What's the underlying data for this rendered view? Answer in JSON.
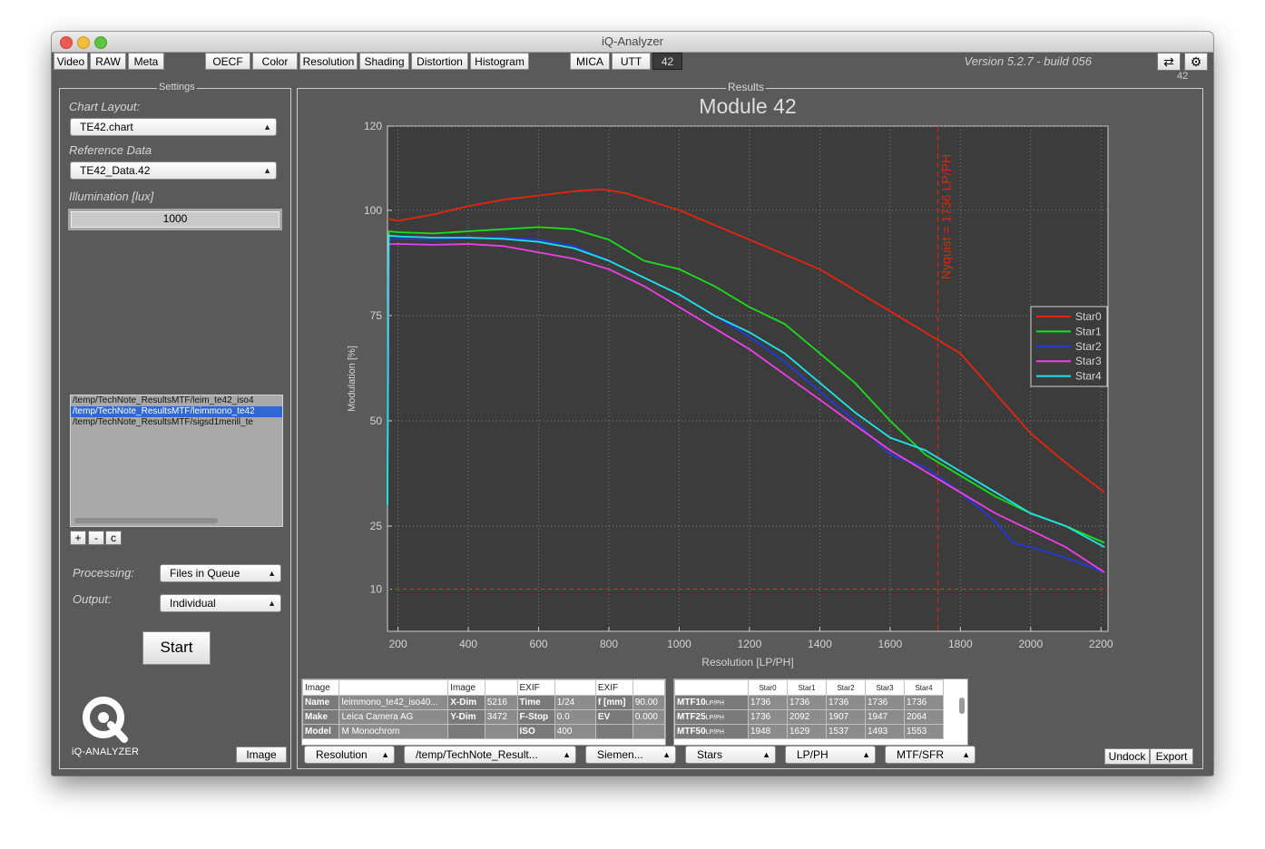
{
  "window": {
    "title": "iQ-Analyzer"
  },
  "toolbar": {
    "tabs": [
      "Video",
      "RAW",
      "Meta",
      "OECF",
      "Color",
      "Resolution",
      "Shading",
      "Distortion",
      "Histogram",
      "MICA",
      "UTT",
      "42"
    ],
    "active_tab": "42",
    "version": "Version 5.2.7 - build 056",
    "swap_icon": "swap-arrows-icon",
    "gear_icon": "gear-icon",
    "corner_label": "42"
  },
  "settings": {
    "group_label": "Settings",
    "chart_layout_label": "Chart Layout:",
    "chart_layout_value": "TE42.chart",
    "reference_label": "Reference Data",
    "reference_value": "TE42_Data.42",
    "illumination_label": "Illumination [lux]",
    "illumination_value": "1000",
    "files": [
      "/temp/TechNote_ResultsMTF/leim_te42_iso4",
      "/temp/TechNote_ResultsMTF/leimmono_te42",
      "/temp/TechNote_ResultsMTF/sigsd1merill_te"
    ],
    "selected_file_index": 1,
    "add_label": "+",
    "remove_label": "-",
    "clear_label": "c",
    "processing_label": "Processing:",
    "processing_value": "Files in Queue",
    "output_label": "Output:",
    "output_value": "Individual",
    "start_label": "Start",
    "logo_text": "iQ-ANALYZER",
    "image_button": "Image"
  },
  "results": {
    "group_label": "Results",
    "exif_table": {
      "headers": [
        "Image",
        "",
        "Image",
        "",
        "EXIF",
        "",
        "EXIF",
        ""
      ],
      "rows": [
        [
          "Name",
          "leimmono_te42_iso40...",
          "X-Dim",
          "5216",
          "Time",
          "1/24",
          "f [mm]",
          "90.00"
        ],
        [
          "Make",
          "Leica Camera AG",
          "Y-Dim",
          "3472",
          "F-Stop",
          "0.0",
          "EV",
          "0.000"
        ],
        [
          "Model",
          "M Monochrom",
          "",
          "",
          "ISO",
          "400",
          "",
          ""
        ]
      ]
    },
    "mtf_table": {
      "headers": [
        "",
        "Star0",
        "Star1",
        "Star2",
        "Star3",
        "Star4"
      ],
      "rows": [
        {
          "label": "MTF10",
          "unit": "LP/PH",
          "values": [
            "1736",
            "1736",
            "1736",
            "1736",
            "1736"
          ]
        },
        {
          "label": "MTF25",
          "unit": "LP/PH",
          "values": [
            "1736",
            "2092",
            "1907",
            "1947",
            "2064"
          ]
        },
        {
          "label": "MTF50",
          "unit": "LP/PH",
          "values": [
            "1948",
            "1629",
            "1537",
            "1493",
            "1553"
          ]
        }
      ]
    },
    "bottom_popups": [
      "Resolution",
      "/temp/TechNote_Result...",
      "Siemen...",
      "Stars",
      "LP/PH",
      "MTF/SFR"
    ],
    "undock_label": "Undock",
    "export_label": "Export"
  },
  "chart_data": {
    "type": "line",
    "title": "Module 42",
    "xlabel": "Resolution [LP/PH]",
    "ylabel": "Modulation [%]",
    "xlim": [
      170,
      2220
    ],
    "ylim": [
      0,
      120
    ],
    "xticks": [
      200,
      400,
      600,
      800,
      1000,
      1200,
      1400,
      1600,
      1800,
      2000,
      2200
    ],
    "yticks": [
      10,
      25,
      50,
      75,
      100,
      120
    ],
    "grid": true,
    "legend_position": "right",
    "nyquist": {
      "x": 1736,
      "label": "Nyquist = 1736 LP/PH",
      "color": "#d52a10"
    },
    "reference_line": {
      "y": 10,
      "color": "#d52a10"
    },
    "series": [
      {
        "name": "Star0",
        "color": "#e8240c",
        "x": [
          170,
          200,
          300,
          400,
          500,
          600,
          700,
          780,
          850,
          1000,
          1200,
          1400,
          1600,
          1700,
          1800,
          2000,
          2100,
          2210
        ],
        "y": [
          98,
          97.5,
          99,
          101,
          102.5,
          103.5,
          104.5,
          105,
          104,
          100,
          93,
          86,
          76,
          71,
          66,
          47,
          40,
          33
        ]
      },
      {
        "name": "Star1",
        "color": "#1adf1c",
        "x": [
          170,
          172,
          174,
          200,
          300,
          400,
          500,
          600,
          700,
          800,
          900,
          1000,
          1100,
          1200,
          1300,
          1400,
          1500,
          1600,
          1700,
          1800,
          1900,
          2000,
          2100,
          2210
        ],
        "y": [
          31,
          75,
          95,
          94.8,
          94.5,
          95,
          95.5,
          96,
          95.5,
          93,
          88,
          86,
          82,
          77,
          73,
          66,
          59,
          50,
          42,
          37,
          32,
          28,
          25,
          21
        ]
      },
      {
        "name": "Star2",
        "color": "#1f3be0",
        "x": [
          170,
          172,
          174,
          200,
          300,
          400,
          500,
          600,
          700,
          800,
          900,
          1000,
          1100,
          1200,
          1300,
          1400,
          1500,
          1600,
          1700,
          1800,
          1900,
          1950,
          2000,
          2100,
          2210
        ],
        "y": [
          40,
          70,
          93,
          93.2,
          93,
          93.3,
          93.5,
          93,
          91.5,
          88,
          84,
          80,
          75,
          70,
          64,
          57,
          50,
          42,
          39,
          33,
          26,
          21,
          20,
          17.5,
          14
        ]
      },
      {
        "name": "Star3",
        "color": "#ef3fe8",
        "x": [
          170,
          172,
          174,
          200,
          300,
          400,
          500,
          600,
          700,
          800,
          900,
          1000,
          1100,
          1200,
          1300,
          1400,
          1500,
          1600,
          1700,
          1800,
          1900,
          2000,
          2100,
          2210
        ],
        "y": [
          40,
          60,
          92,
          92,
          91.8,
          92,
          91.5,
          90,
          88.5,
          86,
          82,
          77,
          72,
          67,
          61,
          55,
          49,
          43,
          38,
          33,
          28,
          24,
          20,
          14
        ]
      },
      {
        "name": "Star4",
        "color": "#1ee6e8",
        "x": [
          170,
          172,
          174,
          200,
          300,
          400,
          500,
          600,
          700,
          800,
          900,
          1000,
          1100,
          1200,
          1300,
          1400,
          1500,
          1600,
          1700,
          1800,
          1900,
          2000,
          2100,
          2210
        ],
        "y": [
          30,
          85,
          94,
          93.8,
          93.5,
          93.5,
          93.2,
          92.5,
          91,
          88,
          84,
          80,
          75,
          71,
          66,
          59,
          52,
          46,
          43,
          38,
          33,
          28,
          25,
          20
        ]
      }
    ]
  }
}
